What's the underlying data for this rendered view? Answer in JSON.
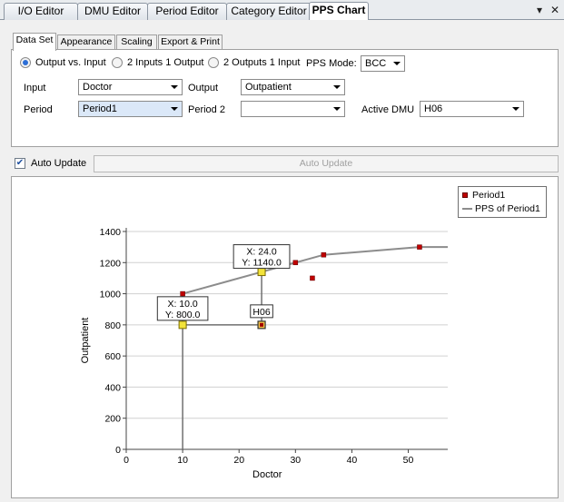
{
  "doc_tabs": [
    "I/O Editor",
    "DMU Editor",
    "Period Editor",
    "Category Editor",
    "PPS Chart"
  ],
  "strip_buttons": {
    "dropdown": "▾",
    "close": "✕"
  },
  "sub_tabs": [
    "Data Set",
    "Appearance",
    "Scaling",
    "Export & Print"
  ],
  "mode_options": [
    "Output vs. Input",
    "2 Inputs 1 Output",
    "2 Outputs 1 Input"
  ],
  "pps_mode": {
    "label": "PPS Mode:",
    "value": "BCC"
  },
  "fields": {
    "input": {
      "label": "Input",
      "value": "Doctor"
    },
    "output": {
      "label": "Output",
      "value": "Outpatient"
    },
    "period": {
      "label": "Period",
      "value": "Period1"
    },
    "period2": {
      "label": "Period 2",
      "value": ""
    },
    "active_dmu": {
      "label": "Active DMU",
      "value": "H06"
    }
  },
  "auto_update": {
    "label": "Auto Update",
    "checked": true,
    "button_label": "Auto Update"
  },
  "chart_data": {
    "type": "scatter",
    "title": "",
    "xlabel": "Doctor",
    "ylabel": "Outpatient",
    "xlim": [
      0,
      57
    ],
    "ylim": [
      0,
      1400
    ],
    "xticks": [
      0,
      10,
      20,
      30,
      40,
      50
    ],
    "yticks": [
      0,
      200,
      400,
      600,
      800,
      1000,
      1200,
      1400
    ],
    "grid": true,
    "legend_placement": "top-right",
    "series": [
      {
        "name": "Period1",
        "kind": "points",
        "color": "#c00000",
        "x": [
          10,
          24,
          30,
          33,
          35,
          52
        ],
        "y": [
          1000,
          800,
          1200,
          1100,
          1250,
          1300
        ]
      },
      {
        "name": "PPS of Period1",
        "kind": "line",
        "color": "#8c8c8c",
        "x": [
          10,
          24,
          30,
          35,
          52,
          57
        ],
        "y": [
          1000,
          1140,
          1200,
          1250,
          1300,
          1300
        ]
      }
    ],
    "projection_points": [
      {
        "x": 10,
        "y": 800,
        "label": [
          "X: 10.0",
          "Y: 800.0"
        ]
      },
      {
        "x": 24,
        "y": 1140,
        "label": [
          "X: 24.0",
          "Y: 1140.0"
        ]
      }
    ],
    "active_point": {
      "x": 24,
      "y": 800,
      "label": "H06"
    }
  }
}
